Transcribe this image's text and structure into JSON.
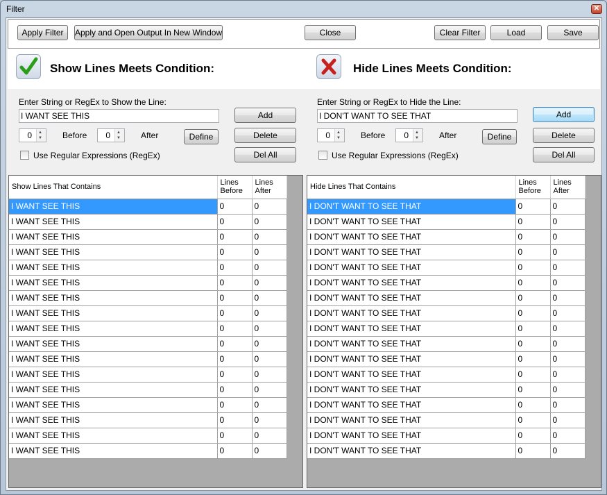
{
  "window": {
    "title": "Filter",
    "close_glyph": "✕"
  },
  "toolbar": {
    "apply_filter": "Apply Filter",
    "apply_open": "Apply and Open Output In New Window",
    "close": "Close",
    "clear_filter": "Clear Filter",
    "load": "Load",
    "save": "Save"
  },
  "show_panel": {
    "title": "Show Lines Meets Condition:",
    "icon": "checkmark-icon",
    "prompt": "Enter String or RegEx to Show the Line:",
    "input_value": "I WANT SEE THIS",
    "before_value": "0",
    "before_label": "Before",
    "after_value": "0",
    "after_label": "After",
    "define": "Define",
    "add": "Add",
    "delete": "Delete",
    "del_all": "Del All",
    "regex_label": "Use Regular Expressions (RegEx)",
    "columns": [
      "Show Lines That Contains",
      "Lines Before",
      "Lines After"
    ],
    "rows": [
      [
        "I WANT SEE THIS",
        "0",
        "0"
      ],
      [
        "I WANT SEE THIS",
        "0",
        "0"
      ],
      [
        "I WANT SEE THIS",
        "0",
        "0"
      ],
      [
        "I WANT SEE THIS",
        "0",
        "0"
      ],
      [
        "I WANT SEE THIS",
        "0",
        "0"
      ],
      [
        "I WANT SEE THIS",
        "0",
        "0"
      ],
      [
        "I WANT SEE THIS",
        "0",
        "0"
      ],
      [
        "I WANT SEE THIS",
        "0",
        "0"
      ],
      [
        "I WANT SEE THIS",
        "0",
        "0"
      ],
      [
        "I WANT SEE THIS",
        "0",
        "0"
      ],
      [
        "I WANT SEE THIS",
        "0",
        "0"
      ],
      [
        "I WANT SEE THIS",
        "0",
        "0"
      ],
      [
        "I WANT SEE THIS",
        "0",
        "0"
      ],
      [
        "I WANT SEE THIS",
        "0",
        "0"
      ],
      [
        "I WANT SEE THIS",
        "0",
        "0"
      ],
      [
        "I WANT SEE THIS",
        "0",
        "0"
      ],
      [
        "I WANT SEE THIS",
        "0",
        "0"
      ]
    ]
  },
  "hide_panel": {
    "title": "Hide Lines Meets Condition:",
    "icon": "red-x-icon",
    "prompt": "Enter String or RegEx to Hide the Line:",
    "input_value": "I DON'T WANT TO SEE THAT",
    "before_value": "0",
    "before_label": "Before",
    "after_value": "0",
    "after_label": "After",
    "define": "Define",
    "add": "Add",
    "delete": "Delete",
    "del_all": "Del All",
    "regex_label": "Use Regular Expressions (RegEx)",
    "columns": [
      "Hide Lines That Contains",
      "Lines Before",
      "Lines After"
    ],
    "rows": [
      [
        "I DON'T WANT TO SEE THAT",
        "0",
        "0"
      ],
      [
        "I DON'T WANT TO SEE THAT",
        "0",
        "0"
      ],
      [
        "I DON'T WANT TO SEE THAT",
        "0",
        "0"
      ],
      [
        "I DON'T WANT TO SEE THAT",
        "0",
        "0"
      ],
      [
        "I DON'T WANT TO SEE THAT",
        "0",
        "0"
      ],
      [
        "I DON'T WANT TO SEE THAT",
        "0",
        "0"
      ],
      [
        "I DON'T WANT TO SEE THAT",
        "0",
        "0"
      ],
      [
        "I DON'T WANT TO SEE THAT",
        "0",
        "0"
      ],
      [
        "I DON'T WANT TO SEE THAT",
        "0",
        "0"
      ],
      [
        "I DON'T WANT TO SEE THAT",
        "0",
        "0"
      ],
      [
        "I DON'T WANT TO SEE THAT",
        "0",
        "0"
      ],
      [
        "I DON'T WANT TO SEE THAT",
        "0",
        "0"
      ],
      [
        "I DON'T WANT TO SEE THAT",
        "0",
        "0"
      ],
      [
        "I DON'T WANT TO SEE THAT",
        "0",
        "0"
      ],
      [
        "I DON'T WANT TO SEE THAT",
        "0",
        "0"
      ],
      [
        "I DON'T WANT TO SEE THAT",
        "0",
        "0"
      ],
      [
        "I DON'T WANT TO SEE THAT",
        "0",
        "0"
      ]
    ]
  },
  "colors": {
    "selection": "#3399ff",
    "grid_background": "#ababab",
    "check_green": "#2a9d1a",
    "x_red": "#c8201c"
  }
}
